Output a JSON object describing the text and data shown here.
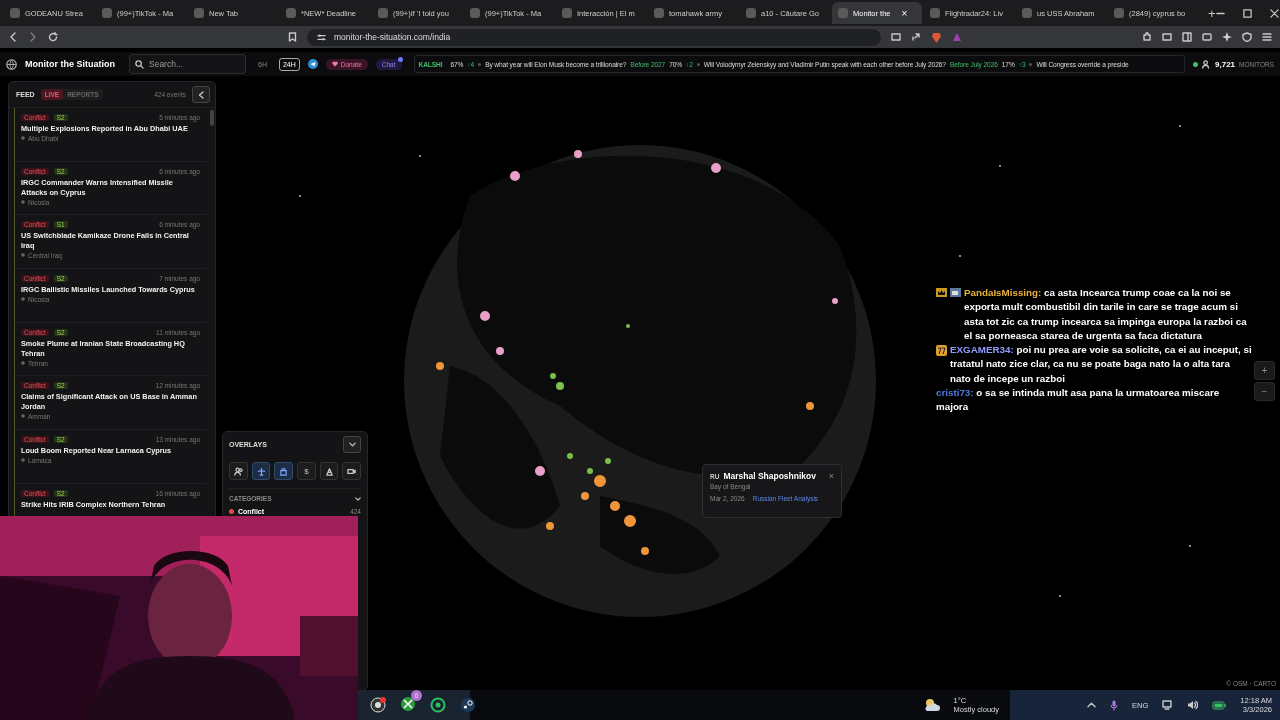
{
  "browser": {
    "tabs": [
      {
        "title": "GODEANU Strea",
        "selected": false
      },
      {
        "title": "(99+)TikTok - Ma",
        "selected": false
      },
      {
        "title": "New Tab",
        "selected": false
      },
      {
        "title": "*NEW* Deadline",
        "selected": false
      },
      {
        "title": "(99+)If 'I told you",
        "selected": false
      },
      {
        "title": "(99+)TikTok - Ma",
        "selected": false
      },
      {
        "title": "Interacción | El m",
        "selected": false
      },
      {
        "title": "tomahawk army",
        "selected": false
      },
      {
        "title": "a10 - Căutare Go",
        "selected": false
      },
      {
        "title": "Monitor the",
        "selected": true
      },
      {
        "title": "Flightradar24: Liv",
        "selected": false
      },
      {
        "title": "us USS Abraham",
        "selected": false
      },
      {
        "title": "(2849) cyprus bo",
        "selected": false
      }
    ],
    "new_tab": "+",
    "close": "×",
    "address": "monitor-the-situation.com/india"
  },
  "header": {
    "title": "Monitor the Situation",
    "search": {
      "placeholder": "Search..."
    },
    "ranges": [
      {
        "label": "6H",
        "selected": false
      },
      {
        "label": "24H",
        "selected": true
      }
    ],
    "donate": "Donate",
    "chat": "Chat",
    "ticker": {
      "source": "KALSHI",
      "lead": {
        "percent": "67%",
        "change": "↑4"
      },
      "markets": [
        {
          "question": "By what year will Elon Musk become a trillionaire?",
          "answer": "Before 2027",
          "percent": "70%",
          "change": "↑2"
        },
        {
          "question": "Will Volodymyr Zelenskyy and Vladimir Putin speak with each other before July 2026?",
          "answer": "Before July 2026",
          "percent": "17%",
          "change": "↑3"
        },
        {
          "question": "Will Congress override a preside"
        }
      ]
    },
    "monitors": {
      "count": "9,721",
      "label": "MONITORS"
    }
  },
  "feed": {
    "title": "FEED",
    "tabs": [
      {
        "label": "LIVE",
        "selected": true
      },
      {
        "label": "REPORTS",
        "selected": false
      }
    ],
    "count": "424 events",
    "items": [
      {
        "category": "Conflict",
        "severity": "S2",
        "time": "5 minutes ago",
        "title": "Multiple Explosions Reported in Abu Dhabi UAE",
        "location": "Abu Dhabi"
      },
      {
        "category": "Conflict",
        "severity": "S2",
        "time": "6 minutes ago",
        "title": "IRGC Commander Warns Intensified Missile Attacks on Cyprus",
        "location": "Nicosia"
      },
      {
        "category": "Conflict",
        "severity": "S1",
        "time": "6 minutes ago",
        "title": "US Switchblade Kamikaze Drone Fails in Central Iraq",
        "location": "Central Iraq"
      },
      {
        "category": "Conflict",
        "severity": "S2",
        "time": "7 minutes ago",
        "title": "IRGC Ballistic Missiles Launched Towards Cyprus",
        "location": "Nicosia"
      },
      {
        "category": "Conflict",
        "severity": "S2",
        "time": "11 minutes ago",
        "title": "Smoke Plume at Iranian State Broadcasting HQ Tehran",
        "location": "Tehran"
      },
      {
        "category": "Conflict",
        "severity": "S2",
        "time": "12 minutes ago",
        "title": "Claims of Significant Attack on US Base in Amman Jordan",
        "location": "Amman"
      },
      {
        "category": "Conflict",
        "severity": "S2",
        "time": "13 minutes ago",
        "title": "Loud Boom Reported Near Larnaca Cyprus",
        "location": "Larnaca"
      },
      {
        "category": "Conflict",
        "severity": "S2",
        "time": "16 minutes ago",
        "title": "Strike Hits IRIB Complex Northern Tehran"
      }
    ]
  },
  "overlays": {
    "title": "OVERLAYS",
    "buttons": [
      {
        "selected": false
      },
      {
        "selected": true
      },
      {
        "selected": true
      },
      {
        "selected": false,
        "label": "$"
      },
      {
        "selected": false
      },
      {
        "selected": false
      }
    ],
    "categories": {
      "title": "CATEGORIES",
      "items": [
        {
          "name": "Conflict",
          "count": "424",
          "color": "#e5484d"
        }
      ]
    }
  },
  "popup": {
    "flag": "RU",
    "name": "Marshal Shaposhnikov",
    "close": "×",
    "location": "Bay of Bengal",
    "date": "Mar 2, 2026",
    "link": "Russian Fleet Analysis"
  },
  "chat": {
    "messages": [
      {
        "user": "PandaIsMissing:",
        "color": "#e9b23c",
        "text": "ca asta Incearca trump coae ca la noi se exporta mult combustibil din tarile in care se trage acum si asta tot zic ca trump incearca sa impinga europa la razboi ca el sa porneasca starea de urgenta sa faca dictatura"
      },
      {
        "user": "EXGAMER34:",
        "color": "#8f9dff",
        "text": "poi nu prea are voie sa solicite, ca ei au inceput, si tratatul nato zice clar, ca nu se poate baga nato la o alta tara nato de incepe un razboi"
      },
      {
        "user": "cristi73:",
        "color": "#4f79d8",
        "text": "o sa se intinda mult asa pana la urmatoarea miscare majora"
      }
    ]
  },
  "zoom": {
    "in": "+",
    "out": "−"
  },
  "attribution": "© OSM · CARTO",
  "taskbar": {
    "badge": "6",
    "temperature": "1°C",
    "weather": "Mostly cloudy",
    "language": "ENG",
    "time": "12:18 AM",
    "date": "3/3/2026"
  }
}
